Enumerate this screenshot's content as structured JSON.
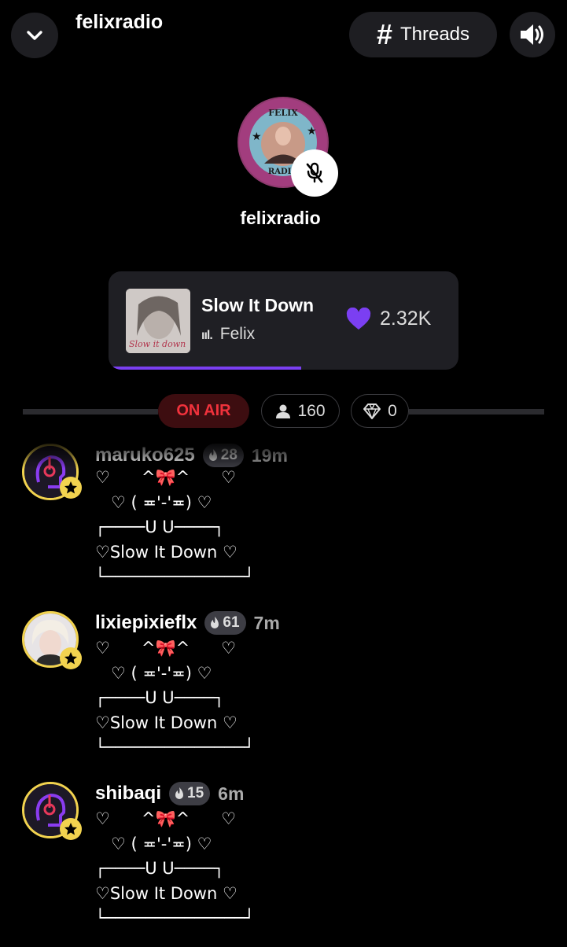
{
  "header": {
    "title": "felixradio",
    "threads_label": "Threads"
  },
  "host": {
    "name": "felixradio",
    "avatar_text_top": "FELIX",
    "avatar_text_bottom": "RADIO"
  },
  "now_playing": {
    "song": "Slow It Down",
    "artist": "Felix",
    "cover_text": "Slow it down",
    "likes": "2.32K",
    "progress": 0.55
  },
  "status": {
    "on_air": "ON AIR",
    "listeners": "160",
    "diamonds": "0"
  },
  "comments": [
    {
      "username": "maruko625",
      "level": "28",
      "time": "19m",
      "text": "♡      ^🎀^      ♡\n   ♡ ( ≖'-'≖) ♡\n┌────U U────┐\n♡Slow It Down ♡\n└──────────────┘"
    },
    {
      "username": "lixiepixieflx",
      "level": "61",
      "time": "7m",
      "text": "♡      ^🎀^      ♡\n   ♡ ( ≖'-'≖) ♡\n┌────U U────┐\n♡Slow It Down ♡\n└──────────────┘"
    },
    {
      "username": "shibaqi",
      "level": "15",
      "time": "6m",
      "text": "♡      ^🎀^      ♡\n   ♡ ( ≖'-'≖) ♡\n┌────U U────┐\n♡Slow It Down ♡\n└──────────────┘"
    }
  ],
  "colors": {
    "accent": "#7b3ff2",
    "on_air": "#f0323c",
    "badge_gold": "#f2d34f"
  }
}
